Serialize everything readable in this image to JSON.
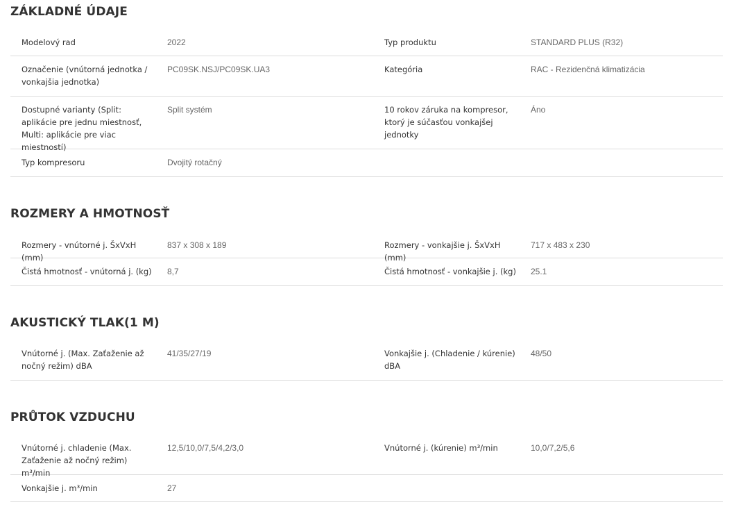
{
  "sections": [
    {
      "title": "ZÁKLADNÉ ÚDAJE",
      "rows": [
        {
          "l1": "Modelový rad",
          "v1": "2022",
          "l2": "Typ produktu",
          "v2": "STANDARD PLUS (R32)"
        },
        {
          "l1": "Označenie (vnútorná jednotka / vonkajšia jednotka)",
          "v1": "PC09SK.NSJ/PC09SK.UA3",
          "l2": "Kategória",
          "v2": "RAC - Rezidenčná klimatizácia"
        },
        {
          "l1": "Dostupné varianty (Split: aplikácie pre jednu miestnosť, Multi: aplikácie pre viac miestností)",
          "v1": "Split systém",
          "l2": "10 rokov záruka na kompresor, ktorý je súčasťou vonkajšej jednotky",
          "v2": "Áno"
        },
        {
          "l1": "Typ kompresoru",
          "v1": "Dvojitý rotačný",
          "l2": "",
          "v2": ""
        }
      ]
    },
    {
      "title": "ROZMERY A HMOTNOSŤ",
      "rows": [
        {
          "l1": "Rozmery - vnútorné j. ŠxVxH (mm)",
          "v1": "837 x 308 x 189",
          "l2": "Rozmery - vonkajšie j. ŠxVxH (mm)",
          "v2": "717 x 483 x 230"
        },
        {
          "l1": "Čistá hmotnosť - vnútorná j. (kg)",
          "v1": "8,7",
          "l2": "Čistá hmotnosť - vonkajšie j. (kg)",
          "v2": "25.1"
        }
      ]
    },
    {
      "title": "AKUSTICKÝ TLAK(1 M)",
      "rows": [
        {
          "l1": "Vnútorné j. (Max. Zaťaženie až nočný režim) dBA",
          "v1": "41/35/27/19",
          "l2": "Vonkajšie j. (Chladenie / kúrenie) dBA",
          "v2": "48/50"
        }
      ]
    },
    {
      "title": "PRŮTOK VZDUCHU",
      "rows": [
        {
          "l1": "Vnútorné j. chladenie (Max. Zaťaženie až nočný režim) m³/min",
          "v1": "12,5/10,0/7,5/4,2/3,0",
          "l2": "Vnútorné j. (kúrenie) m³/min",
          "v2": "10,0/7,2/5,6"
        },
        {
          "l1": "Vonkajšie j. m³/min",
          "v1": "27",
          "l2": "",
          "v2": ""
        }
      ]
    }
  ]
}
